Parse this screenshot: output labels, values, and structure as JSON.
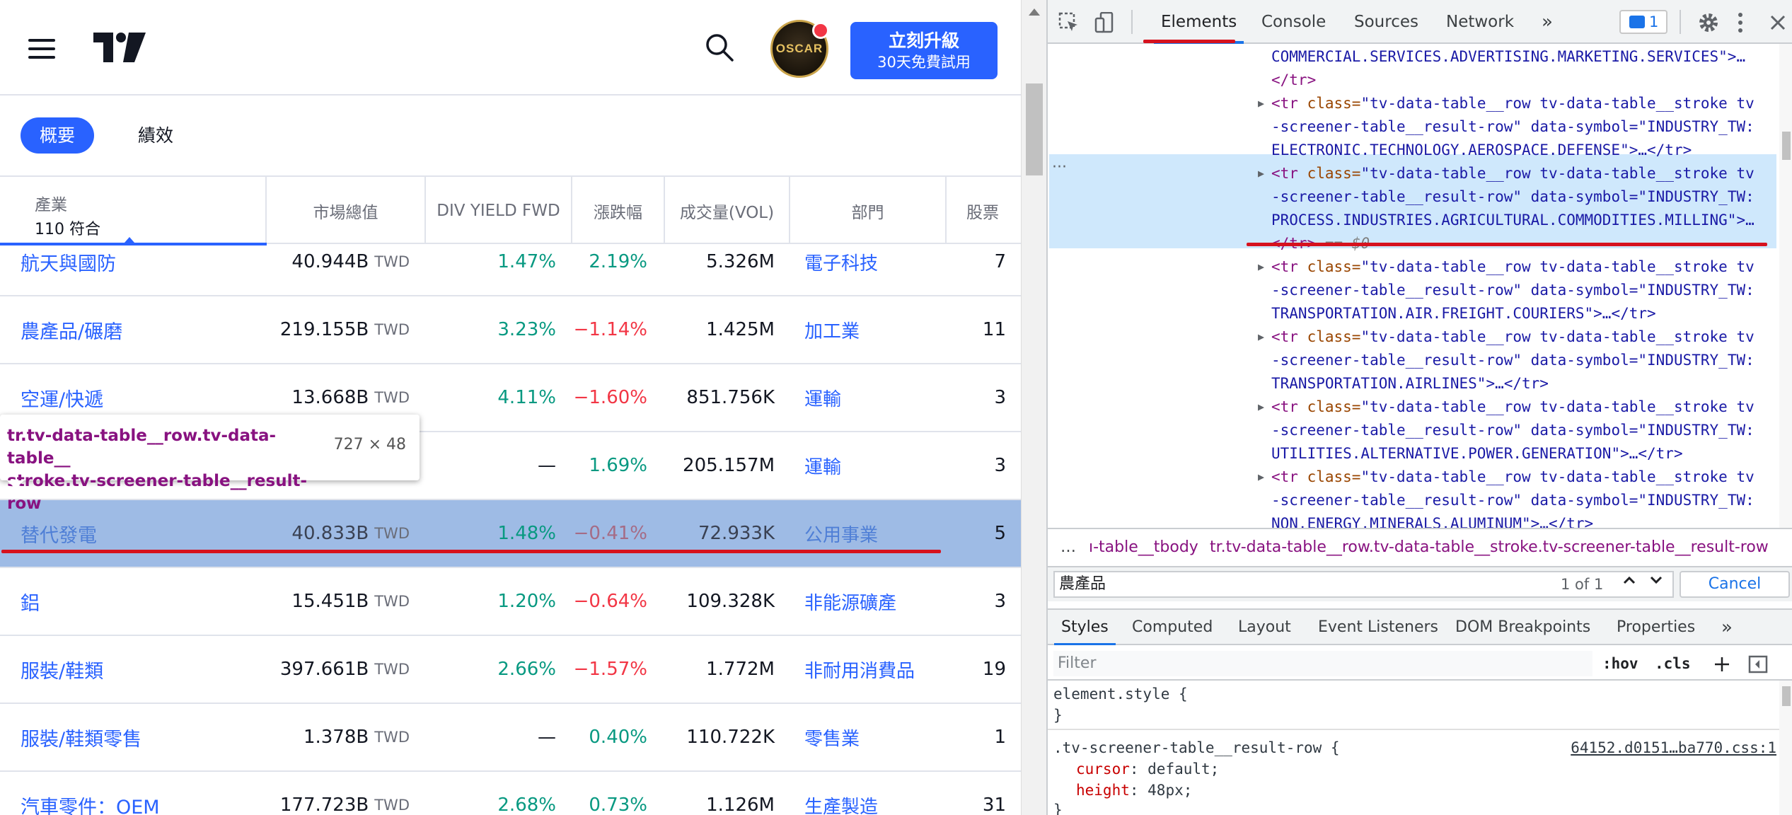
{
  "app": {
    "upgrade_line1": "立刻升級",
    "upgrade_line2": "30天免費試用",
    "avatar_text": "OSCAR"
  },
  "tabs": [
    {
      "label": "概要",
      "active": true
    },
    {
      "label": "績效",
      "active": false
    }
  ],
  "table": {
    "header_industry": "產業",
    "header_count": "110 符合",
    "columns": [
      "市場總值",
      "DIV YIELD FWD",
      "漲跌幅",
      "成交量(VOL)",
      "部門",
      "股票"
    ],
    "rows": [
      {
        "name": "航天與國防",
        "mcap": "40.944B",
        "unit": "TWD",
        "div": "1.47%",
        "chg": "2.19%",
        "chg_sign": "pos",
        "vol": "5.326M",
        "sector": "電子科技",
        "stocks": "7"
      },
      {
        "name": "農產品/碾磨",
        "mcap": "219.155B",
        "unit": "TWD",
        "div": "3.23%",
        "chg": "−1.14%",
        "chg_sign": "neg",
        "vol": "1.425M",
        "sector": "加工業",
        "stocks": "11"
      },
      {
        "name": "空運/快遞",
        "mcap": "13.668B",
        "unit": "TWD",
        "div": "4.11%",
        "chg": "−1.60%",
        "chg_sign": "neg",
        "vol": "851.756K",
        "sector": "運輸",
        "stocks": "3"
      },
      {
        "name": "",
        "mcap": "",
        "unit": "",
        "div": "—",
        "chg": "1.69%",
        "chg_sign": "pos",
        "vol": "205.157M",
        "sector": "運輸",
        "stocks": "3"
      },
      {
        "name": "替代發電",
        "mcap": "40.833B",
        "unit": "TWD",
        "div": "1.48%",
        "chg": "−0.41%",
        "chg_sign": "neg",
        "vol": "72.933K",
        "sector": "公用事業",
        "stocks": "5",
        "highlight": true
      },
      {
        "name": "鋁",
        "mcap": "15.451B",
        "unit": "TWD",
        "div": "1.20%",
        "chg": "−0.64%",
        "chg_sign": "neg",
        "vol": "109.328K",
        "sector": "非能源礦產",
        "stocks": "3"
      },
      {
        "name": "服裝/鞋類",
        "mcap": "397.661B",
        "unit": "TWD",
        "div": "2.66%",
        "chg": "−1.57%",
        "chg_sign": "neg",
        "vol": "1.772M",
        "sector": "非耐用消費品",
        "stocks": "19"
      },
      {
        "name": "服裝/鞋類零售",
        "mcap": "1.378B",
        "unit": "TWD",
        "div": "—",
        "chg": "0.40%",
        "chg_sign": "pos",
        "vol": "110.722K",
        "sector": "零售業",
        "stocks": "1"
      },
      {
        "name": "汽車零件：OEM",
        "mcap": "177.723B",
        "unit": "TWD",
        "div": "2.68%",
        "chg": "0.73%",
        "chg_sign": "pos",
        "vol": "1.126M",
        "sector": "生產製造",
        "stocks": "31"
      }
    ]
  },
  "tooltip": {
    "sel_part1": "tr.tv-data-table__row.tv-data-table__",
    "sel_part2": "stroke.tv-screener-table__result-row",
    "dims": "727 × 48"
  },
  "devtools": {
    "tabs": [
      "Elements",
      "Console",
      "Sources",
      "Network"
    ],
    "more": "»",
    "msg_count": "1",
    "dom_lines": [
      {
        "kind": "text",
        "text": "COMMERCIAL.SERVICES.ADVERTISING.MARKETING.SERVICES\">…"
      },
      {
        "kind": "close",
        "text": "</tr>"
      },
      {
        "kind": "open",
        "text": "<tr class=\"tv-data-table__row tv-data-table__stroke tv"
      },
      {
        "kind": "cont",
        "text": "-screener-table__result-row\" data-symbol=\"INDUSTRY_TW:"
      },
      {
        "kind": "cont",
        "text": "ELECTRONIC.TECHNOLOGY.AEROSPACE.DEFENSE\">…</tr>"
      },
      {
        "kind": "open",
        "text": "<tr class=\"tv-data-table__row tv-data-table__stroke tv"
      },
      {
        "kind": "cont",
        "text": "-screener-table__result-row\" data-symbol=\"INDUSTRY_TW:"
      },
      {
        "kind": "cont",
        "text": "PROCESS.INDUSTRIES.AGRICULTURAL.COMMODITIES.MILLING\">…"
      },
      {
        "kind": "close",
        "text": "</tr>"
      },
      {
        "kind": "open",
        "text": "<tr class=\"tv-data-table__row tv-data-table__stroke tv"
      },
      {
        "kind": "cont",
        "text": "-screener-table__result-row\" data-symbol=\"INDUSTRY_TW:"
      },
      {
        "kind": "cont",
        "text": "TRANSPORTATION.AIR.FREIGHT.COURIERS\">…</tr>"
      },
      {
        "kind": "open",
        "text": "<tr class=\"tv-data-table__row tv-data-table__stroke tv"
      },
      {
        "kind": "cont",
        "text": "-screener-table__result-row\" data-symbol=\"INDUSTRY_TW:"
      },
      {
        "kind": "cont",
        "text": "TRANSPORTATION.AIRLINES\">…</tr>"
      },
      {
        "kind": "open",
        "text": "<tr class=\"tv-data-table__row tv-data-table__stroke tv"
      },
      {
        "kind": "cont",
        "text": "-screener-table__result-row\" data-symbol=\"INDUSTRY_TW:"
      },
      {
        "kind": "cont",
        "text": "UTILITIES.ALTERNATIVE.POWER.GENERATION\">…</tr>"
      },
      {
        "kind": "open",
        "text": "<tr class=\"tv-data-table__row tv-data-table__stroke tv"
      },
      {
        "kind": "cont",
        "text": "-screener-table__result-row\" data-symbol=\"INDUSTRY_TW:"
      },
      {
        "kind": "cont",
        "text": "NON.ENERGY.MINERALS.ALUMINUM\">…</tr>"
      }
    ],
    "selected_suffix": " == $0",
    "crumbs": {
      "dots": "…",
      "c1": "ı-table__tbody",
      "c2": "tr.tv-data-table__row.tv-data-table__stroke.tv-screener-table__result-row"
    },
    "find": {
      "query": "農產品",
      "count": "1 of 1",
      "cancel": "Cancel"
    },
    "subtabs": [
      "Styles",
      "Computed",
      "Layout",
      "Event Listeners",
      "DOM Breakpoints",
      "Properties"
    ],
    "filter_placeholder": "Filter",
    "hov": ":hov",
    "cls": ".cls",
    "styles": {
      "element_style": "element.style {",
      "close1": "}",
      "rule_selector": ".tv-screener-table__result-row {",
      "source_link": "64152.d0151…ba770.css:1",
      "decl1_prop": "cursor",
      "decl1_val": "default;",
      "decl2_prop": "height",
      "decl2_val": "48px;",
      "close2": "}"
    }
  }
}
